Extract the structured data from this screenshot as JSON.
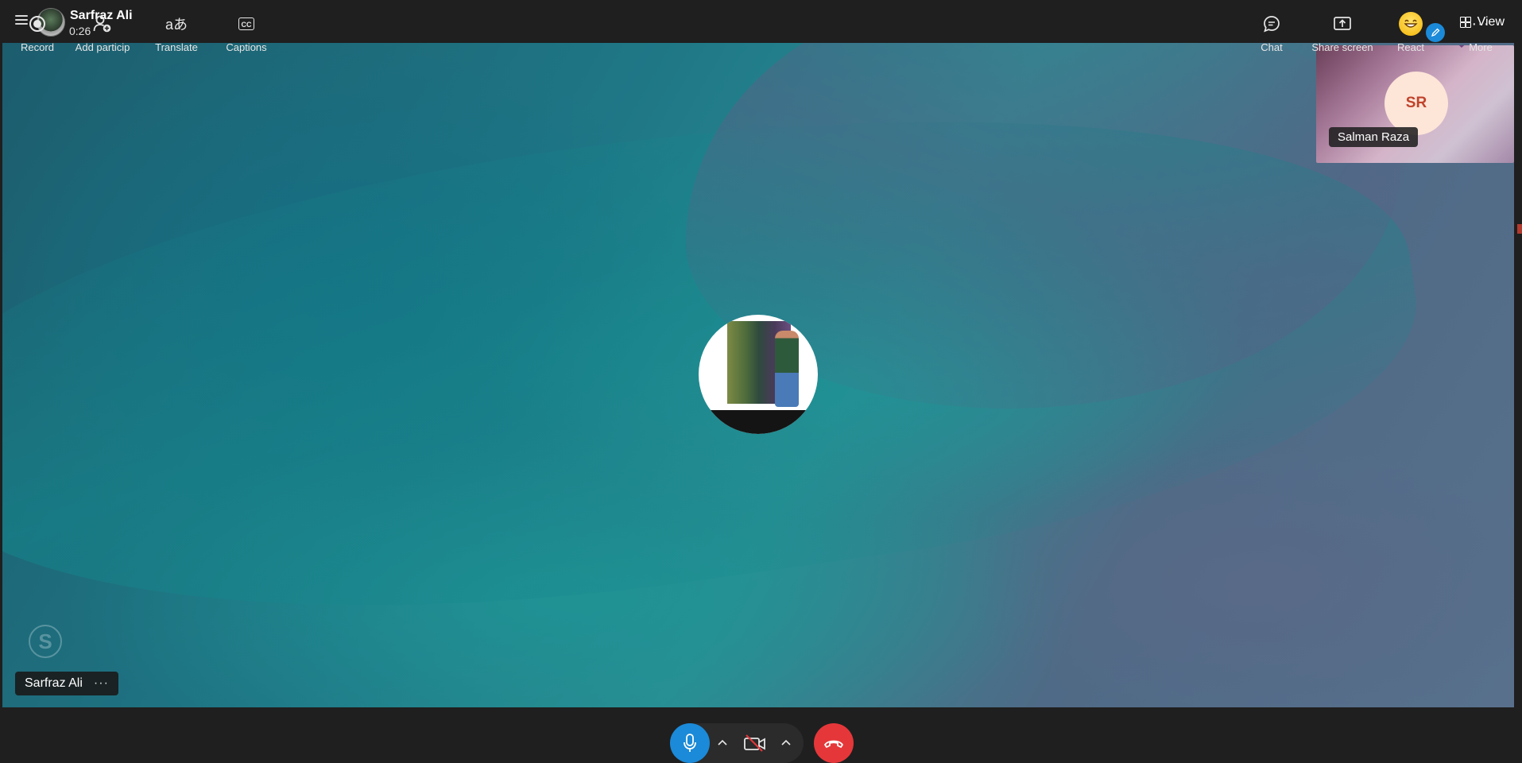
{
  "header": {
    "caller_name": "Sarfraz Ali",
    "call_timer": "0:26",
    "view_label": "View"
  },
  "stage": {
    "remote_participant": {
      "initials": "SR",
      "name": "Salman Raza"
    },
    "self_label": "Sarfraz Ali",
    "self_more": "···"
  },
  "toolbar": {
    "left": [
      {
        "label": "Record",
        "icon": "record-icon"
      },
      {
        "label": "Add particip",
        "icon": "add-participant-icon"
      },
      {
        "label": "Translate",
        "icon": "translate-icon"
      },
      {
        "label": "Captions",
        "icon": "captions-icon"
      }
    ],
    "right": [
      {
        "label": "Chat",
        "icon": "chat-icon"
      },
      {
        "label": "Share screen",
        "icon": "share-screen-icon"
      },
      {
        "label": "React",
        "icon": "react-icon"
      },
      {
        "label": "More",
        "icon": "more-icon"
      }
    ],
    "translate_glyph": "aあ",
    "captions_glyph": "CC",
    "more_glyph": "···"
  },
  "colors": {
    "mic_active": "#1b8ad8",
    "end_call": "#e5373a",
    "bar_background": "#1f1f1f",
    "avatar_initials": "#c0432b"
  }
}
